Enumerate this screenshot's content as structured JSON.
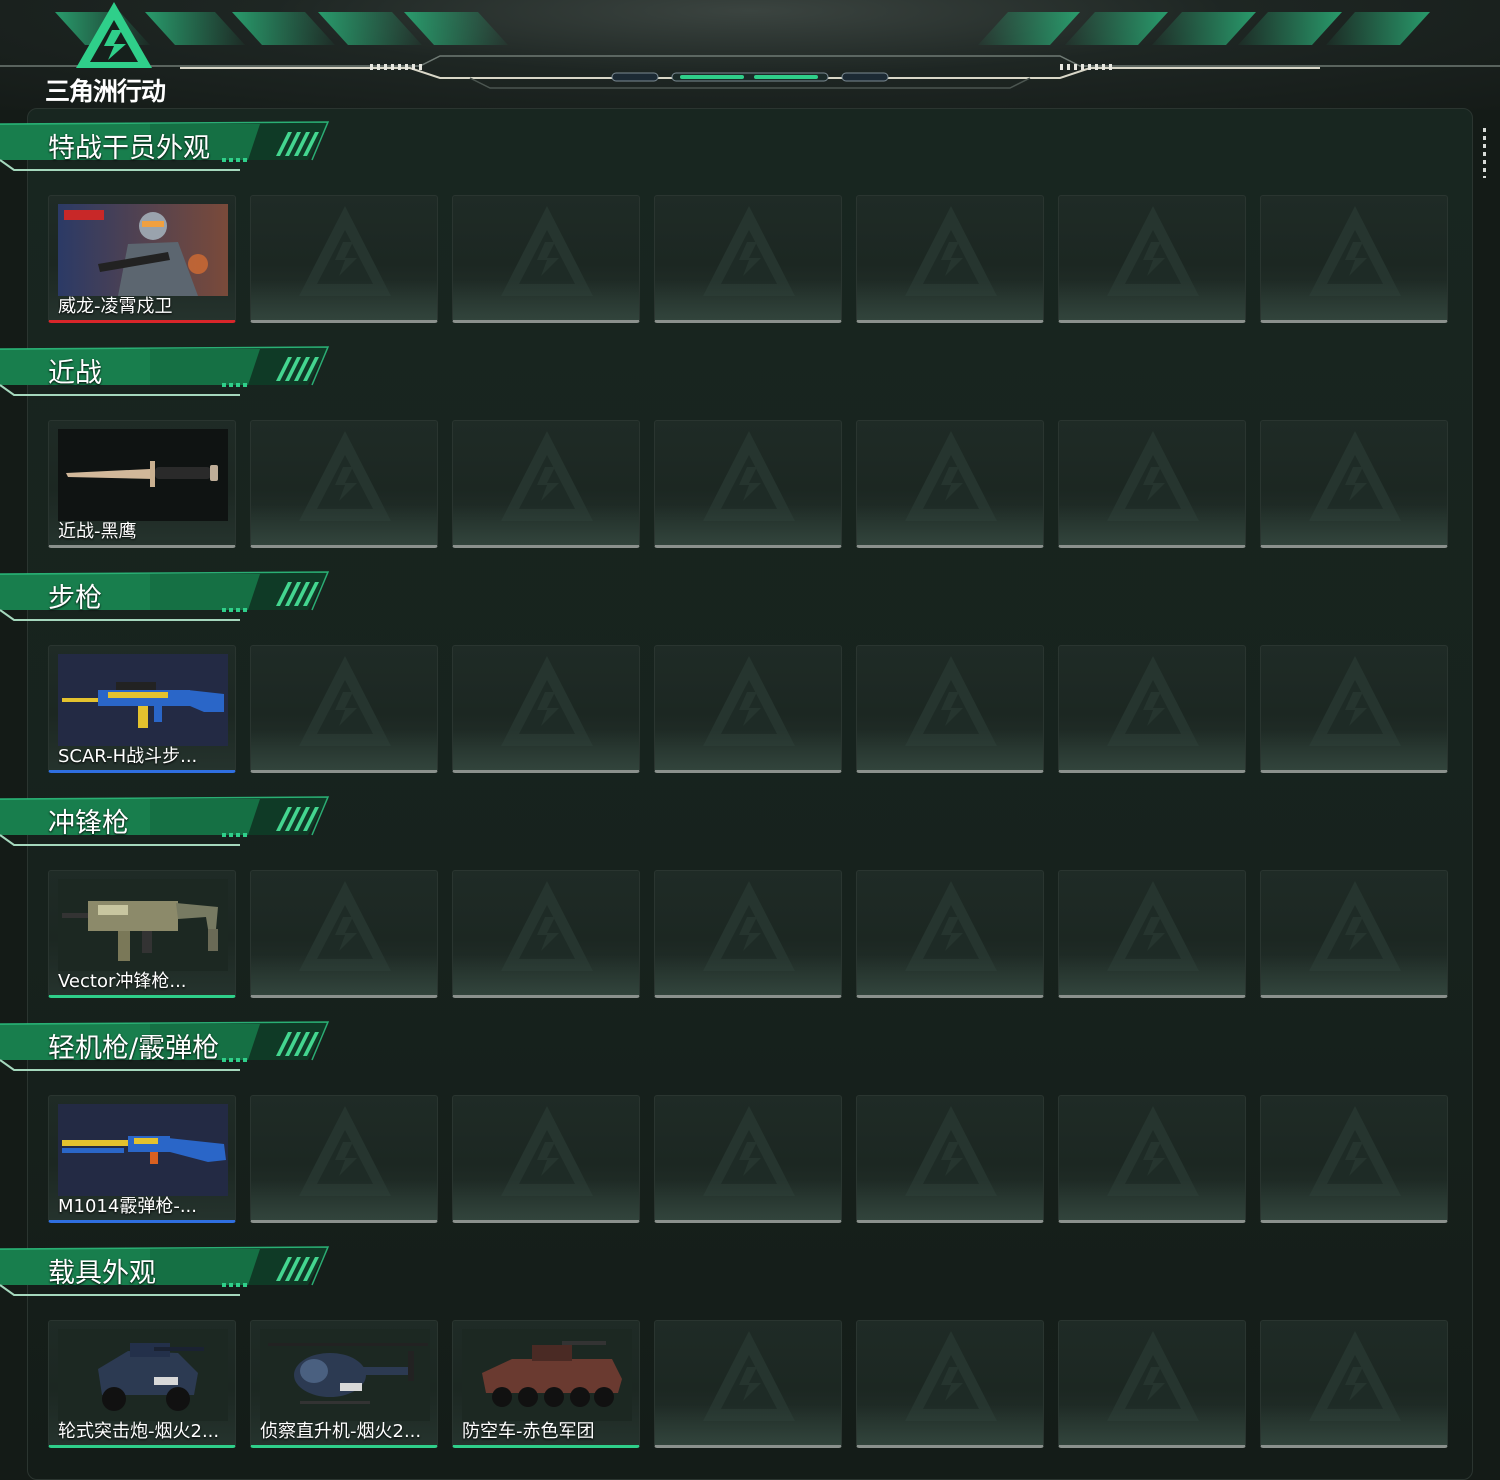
{
  "app": {
    "logo_text": "三角洲行动"
  },
  "colors": {
    "accent_green": "#2fcf8a",
    "quality_red": "#d8262a",
    "quality_blue": "#2f6fe0",
    "quality_green": "#2fcf8a",
    "empty_slot": "#8b918d"
  },
  "sections": [
    {
      "title": "特战干员外观",
      "items": [
        {
          "name": "威龙-凌霄戍卫",
          "quality": "red",
          "icon": "operator-portrait-icon"
        }
      ]
    },
    {
      "title": "近战",
      "items": [
        {
          "name": "近战-黑鹰",
          "quality": "gray",
          "icon": "knife-icon"
        }
      ]
    },
    {
      "title": "步枪",
      "items": [
        {
          "name": "SCAR-H战斗步...",
          "quality": "blue",
          "icon": "rifle-icon"
        }
      ]
    },
    {
      "title": "冲锋枪",
      "items": [
        {
          "name": "Vector冲锋枪...",
          "quality": "green",
          "icon": "smg-icon"
        }
      ]
    },
    {
      "title": "轻机枪/霰弹枪",
      "items": [
        {
          "name": "M1014霰弹枪-...",
          "quality": "blue",
          "icon": "shotgun-icon"
        }
      ]
    },
    {
      "title": "载具外观",
      "items": [
        {
          "name": "轮式突击炮-烟火2...",
          "quality": "green",
          "icon": "armored-car-icon"
        },
        {
          "name": "侦察直升机-烟火2...",
          "quality": "green",
          "icon": "helicopter-icon"
        },
        {
          "name": "防空车-赤色军团",
          "quality": "green",
          "icon": "aa-vehicle-icon"
        }
      ]
    }
  ],
  "slots_per_row": 7
}
